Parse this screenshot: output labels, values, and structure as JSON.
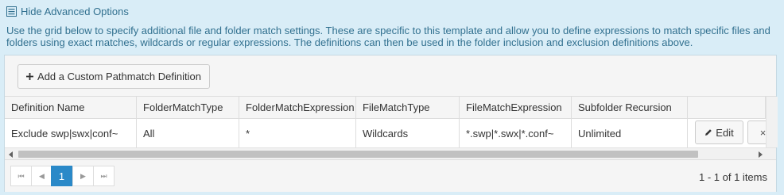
{
  "options_toggle": {
    "label": "Hide Advanced Options",
    "icon": "list-box-icon"
  },
  "description": "Use the grid below to specify additional file and folder match settings. These are specific to this template and allow you to define expressions to match specific files and folders using exact matches, wildcards or regular expressions. The definitions can then be used in the folder inclusion and exclusion definitions above.",
  "toolbar": {
    "add_label": "Add a Custom Pathmatch Definition",
    "add_icon": "plus-icon"
  },
  "columns": [
    "Definition Name",
    "FolderMatchType",
    "FolderMatchExpression",
    "FileMatchType",
    "FileMatchExpression",
    "Subfolder Recursion"
  ],
  "rows": [
    {
      "definition_name": "Exclude swp|swx|conf~",
      "folder_match_type": "All",
      "folder_match_expression": "*",
      "file_match_type": "Wildcards",
      "file_match_expression": "*.swp|*.swx|*.conf~",
      "subfolder_recursion": "Unlimited",
      "edit_label": "Edit",
      "delete_label": "×"
    }
  ],
  "pager": {
    "first_glyph": "⏮",
    "prev_glyph": "◀",
    "current_page": "1",
    "next_glyph": "▶",
    "last_glyph": "⏭",
    "info": "1 - 1 of 1 items"
  },
  "colors": {
    "panel_bg": "#d9edf7",
    "text": "#31708f",
    "page_active": "#2a89c8"
  }
}
